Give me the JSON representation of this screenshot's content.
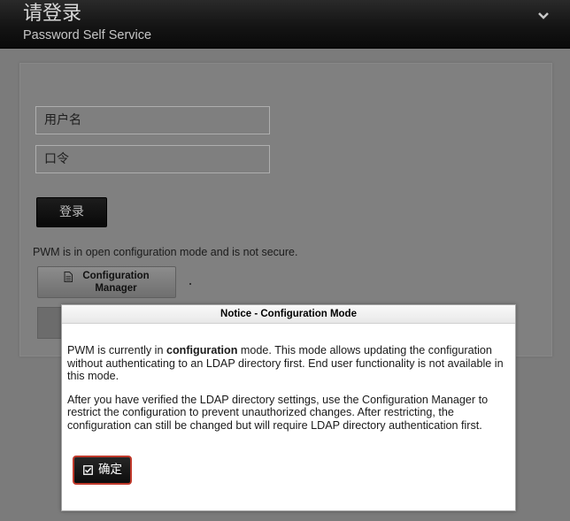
{
  "header": {
    "title": "请登录",
    "subtitle": "Password Self Service",
    "menu_icon": "chevron-down-icon"
  },
  "login": {
    "username_placeholder": "用户名",
    "password_placeholder": "口令",
    "login_label": "登录",
    "warning": "PWM is in open configuration mode and is not secure.",
    "config_button_line1": "Configuration",
    "config_button_line2": "Manager",
    "config_button_icon": "document-icon"
  },
  "dialog": {
    "title": "Notice - Configuration Mode",
    "p1_before": "PWM is currently in ",
    "p1_bold": "configuration",
    "p1_after": " mode. This mode allows updating the configuration without authenticating to an LDAP directory first. End user functionality is not available in this mode.",
    "p2": "After you have verified the LDAP directory settings, use the Configuration Manager to restrict the configuration to prevent unauthorized changes. After restricting, the configuration can still be changed but will require LDAP directory authentication first.",
    "ok_label": "确定",
    "ok_icon": "checkbox-icon"
  },
  "colors": {
    "header_bg": "#141414",
    "page_bg": "#7b7b7b",
    "ok_border": "#c0392b"
  }
}
